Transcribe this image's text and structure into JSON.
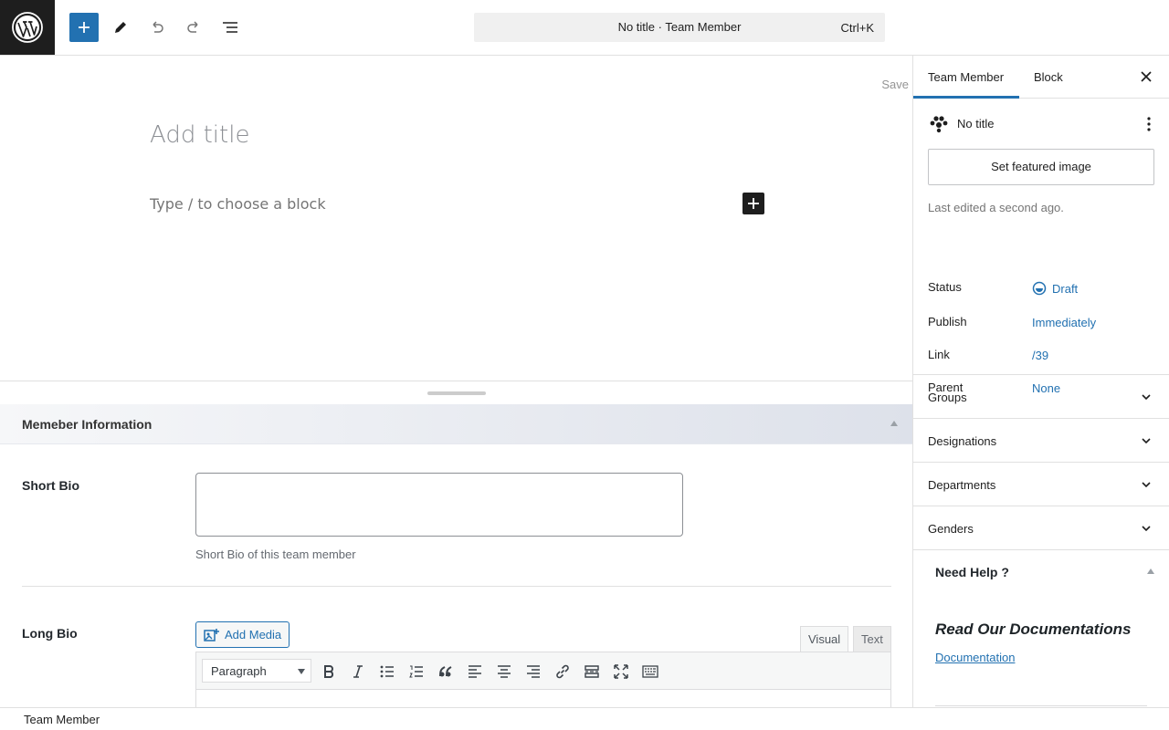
{
  "topbar": {
    "document_title": "No title · Team Member",
    "shortcut": "Ctrl+K"
  },
  "canvas": {
    "save_label": "Save",
    "title_placeholder": "Add title",
    "block_placeholder": "Type / to choose a block"
  },
  "metabox": {
    "title": "Memeber Information",
    "short_bio_label": "Short Bio",
    "short_bio_value": "",
    "short_bio_desc": "Short Bio of this team member",
    "long_bio_label": "Long Bio",
    "add_media_label": "Add Media",
    "tab_visual": "Visual",
    "tab_text": "Text",
    "format_select": "Paragraph"
  },
  "footer": {
    "breadcrumb": "Team Member"
  },
  "sidebar": {
    "tab_document": "Team Member",
    "tab_block": "Block",
    "doc_title": "No title",
    "featured_image_label": "Set featured image",
    "last_edited": "Last edited a second ago.",
    "props": [
      {
        "key": "Status",
        "value": "Draft"
      },
      {
        "key": "Publish",
        "value": "Immediately"
      },
      {
        "key": "Link",
        "value": "/39"
      },
      {
        "key": "Parent",
        "value": "None"
      }
    ],
    "panels": [
      "Groups",
      "Designations",
      "Departments",
      "Genders"
    ],
    "help": {
      "title": "Need Help ?",
      "heading": "Read Our Documentations",
      "link": "Documentation"
    }
  },
  "colors": {
    "accent": "#2271b1",
    "dark": "#1e1e1e",
    "border": "#e0e0e0"
  },
  "icons": [
    "wordpress-logo-icon",
    "plus-icon",
    "pencil-icon",
    "undo-icon",
    "redo-icon",
    "list-view-icon",
    "close-icon",
    "team-icon",
    "more-vertical-icon",
    "draft-status-icon",
    "chevron-down-icon"
  ]
}
